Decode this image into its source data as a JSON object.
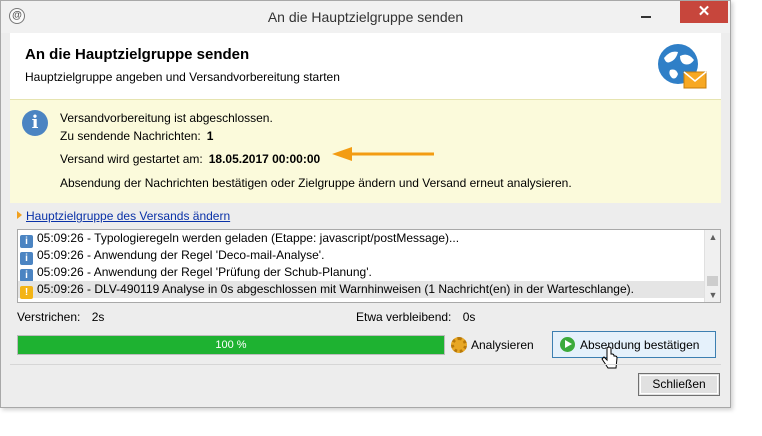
{
  "window": {
    "title": "An die Hauptzielgruppe senden",
    "close_glyph": "✕"
  },
  "header": {
    "title": "An die Hauptzielgruppe senden",
    "subtitle": "Hauptzielgruppe angeben und Versandvorbereitung starten",
    "icon": "globe-mail-icon"
  },
  "info": {
    "icon": "info-icon",
    "line1": "Versandvorbereitung ist abgeschlossen.",
    "messages_label": "Zu sendende Nachrichten:",
    "messages_value": "1",
    "start_label": "Versand wird gestartet am:",
    "start_value": "18.05.2017 00:00:00",
    "line4": "Absendung der Nachrichten bestätigen oder Zielgruppe ändern und Versand erneut analysieren.",
    "arrow_color": "#f39c12"
  },
  "link": {
    "label": "Hauptzielgruppe des Versands ändern"
  },
  "log": {
    "rows": [
      {
        "type": "info",
        "text": "05:09:26 - Typologieregeln werden geladen (Etappe: javascript/postMessage)..."
      },
      {
        "type": "info",
        "text": "05:09:26 - Anwendung der Regel 'Deco-mail-Analyse'."
      },
      {
        "type": "info",
        "text": "05:09:26 - Anwendung der Regel 'Prüfung der Schub-Planung'."
      },
      {
        "type": "warn",
        "text": "05:09:26 - DLV-490119 Analyse in 0s abgeschlossen mit Warnhinweisen (1 Nachricht(en) in der Warteschlange)."
      }
    ]
  },
  "stats": {
    "elapsed_label": "Verstrichen:",
    "elapsed_value": "2s",
    "remaining_label": "Etwa verbleibend:",
    "remaining_value": "0s"
  },
  "progress": {
    "percent": 100,
    "label": "100 %",
    "color": "#1eb231"
  },
  "actions": {
    "analyze_label": "Analysieren",
    "confirm_label": "Absendung bestätigen",
    "close_label": "Schließen"
  }
}
